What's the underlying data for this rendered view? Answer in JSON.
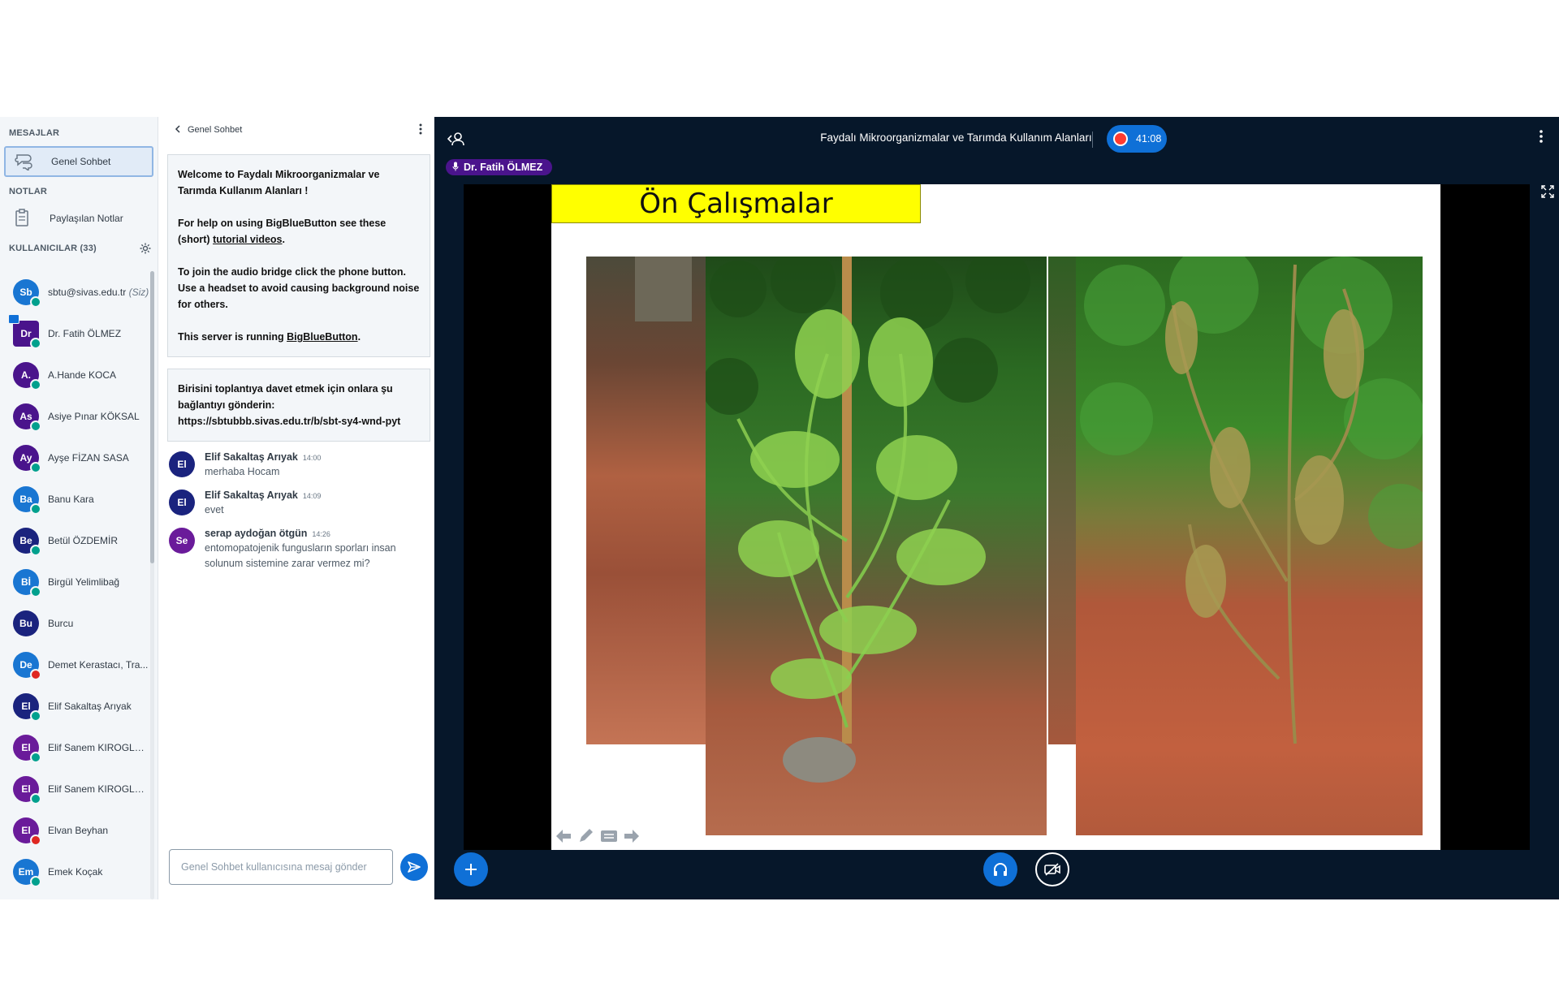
{
  "panel": {
    "messages_title": "MESAJLAR",
    "public_chat": "Genel Sohbet",
    "notes_title": "NOTLAR",
    "shared_notes": "Paylaşılan Notlar",
    "users_title": "KULLANICILAR (33)"
  },
  "users": [
    {
      "initials": "Sb",
      "name": "sbtu@sivas.edu.tr",
      "suffix": "(Siz)",
      "color": "#1976d2",
      "status": "audio"
    },
    {
      "initials": "Dr",
      "name": "Dr. Fatih ÖLMEZ",
      "suffix": "",
      "color": "#4a148c",
      "status": "audio",
      "presenter": true
    },
    {
      "initials": "A.",
      "name": "A.Hande KOCA",
      "suffix": "",
      "color": "#4a148c",
      "status": "audio"
    },
    {
      "initials": "As",
      "name": "Asiye Pınar KÖKSAL",
      "suffix": "",
      "color": "#4a148c",
      "status": "audio"
    },
    {
      "initials": "Ay",
      "name": "Ayşe FİZAN SASA",
      "suffix": "",
      "color": "#4a148c",
      "status": "audio"
    },
    {
      "initials": "Ba",
      "name": "Banu Kara",
      "suffix": "",
      "color": "#1976d2",
      "status": "audio"
    },
    {
      "initials": "Be",
      "name": "Betül ÖZDEMİR",
      "suffix": "",
      "color": "#1a237e",
      "status": "audio"
    },
    {
      "initials": "Bİ",
      "name": "Birgül Yelimlibağ",
      "suffix": "",
      "color": "#1976d2",
      "status": "audio"
    },
    {
      "initials": "Bu",
      "name": "Burcu",
      "suffix": "",
      "color": "#1a237e",
      "status": "none"
    },
    {
      "initials": "De",
      "name": "Demet Kerastacı, Tra...",
      "suffix": "",
      "color": "#1976d2",
      "status": "muted"
    },
    {
      "initials": "El",
      "name": "Elif Sakaltaş Arıyak",
      "suffix": "",
      "color": "#1a237e",
      "status": "audio"
    },
    {
      "initials": "El",
      "name": "Elif Sanem KIROGLU /...",
      "suffix": "",
      "color": "#6a1b9a",
      "status": "audio"
    },
    {
      "initials": "El",
      "name": "Elif Sanem KIROGLU /...",
      "suffix": "",
      "color": "#6a1b9a",
      "status": "audio"
    },
    {
      "initials": "El",
      "name": "Elvan Beyhan",
      "suffix": "",
      "color": "#6a1b9a",
      "status": "muted"
    },
    {
      "initials": "Em",
      "name": "Emek Koçak",
      "suffix": "",
      "color": "#1976d2",
      "status": "audio"
    }
  ],
  "chat": {
    "header": "Genel Sohbet",
    "welcome_intro": "Welcome to ",
    "welcome_title": "Faydalı Mikroorganizmalar ve Tarımda Kullanım Alanları",
    "welcome_end": " !",
    "help_pre": "For help on using BigBlueButton see these (short) ",
    "help_link": "tutorial videos",
    "help_post": ".",
    "audio_info": "To join the audio bridge click the phone button.  Use a headset to avoid causing background noise for others.",
    "server_pre": "This server is running ",
    "server_link": "BigBlueButton",
    "server_post": ".",
    "invite_text": "Birisini toplantıya davet etmek için onlara şu bağlantıyı gönderin:",
    "invite_link": "https://sbtubbb.sivas.edu.tr/b/sbt-sy4-wnd-pyt",
    "messages": [
      {
        "initials": "El",
        "author": "Elif Sakaltaş Arıyak",
        "time": "14:00",
        "text": "merhaba Hocam",
        "color": "#1a237e"
      },
      {
        "initials": "El",
        "author": "Elif Sakaltaş Arıyak",
        "time": "14:09",
        "text": "evet",
        "color": "#1a237e"
      },
      {
        "initials": "Se",
        "author": "serap aydoğan ötgün",
        "time": "14:26",
        "text": "entomopatojenik fungusların sporları insan solunum sistemine zarar vermez mi?",
        "color": "#6a1b9a"
      }
    ],
    "composer_placeholder": "Genel Sohbet kullanıcısına mesaj gönder"
  },
  "stage": {
    "meeting_title": "Faydalı Mikroorganizmalar ve Tarımda Kullanım Alanları",
    "recording_time": "41:08",
    "talker": "Dr. Fatih ÖLMEZ",
    "slide_title": "Ön Çalışmalar"
  },
  "colors": {
    "primary": "#0f70d7",
    "stage_bg": "#06172a",
    "muted": "#df2721",
    "audio": "#00a08d"
  }
}
